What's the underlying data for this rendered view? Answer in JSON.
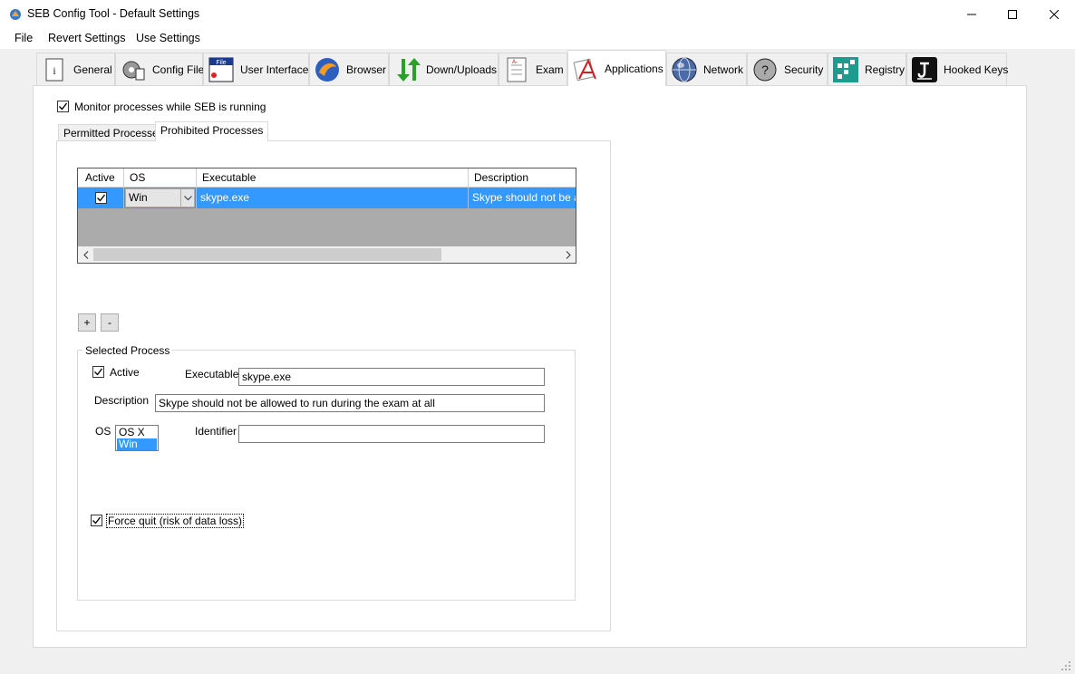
{
  "window": {
    "title": "SEB Config Tool - Default Settings",
    "controls": {
      "minimize": "—",
      "maximize": "☐",
      "close": "✕"
    }
  },
  "menu": {
    "items": [
      "File",
      "Revert Settings",
      "Use Settings"
    ]
  },
  "tabs": [
    {
      "label": "General",
      "icon": "general-icon"
    },
    {
      "label": "Config File",
      "icon": "config-file-icon"
    },
    {
      "label": "User Interface",
      "icon": "user-interface-icon"
    },
    {
      "label": "Browser",
      "icon": "browser-icon"
    },
    {
      "label": "Down/Uploads",
      "icon": "down-uploads-icon"
    },
    {
      "label": "Exam",
      "icon": "exam-icon"
    },
    {
      "label": "Applications",
      "icon": "applications-icon",
      "active": true
    },
    {
      "label": "Network",
      "icon": "network-icon"
    },
    {
      "label": "Security",
      "icon": "security-icon"
    },
    {
      "label": "Registry",
      "icon": "registry-icon"
    },
    {
      "label": "Hooked Keys",
      "icon": "hooked-keys-icon"
    }
  ],
  "applications": {
    "monitor_processes": {
      "label": "Monitor processes while SEB is running",
      "checked": true
    },
    "subtabs": [
      "Permitted Processes",
      "Prohibited Processes"
    ],
    "active_subtab": "Prohibited Processes",
    "grid": {
      "columns": [
        "Active",
        "OS",
        "Executable",
        "Description"
      ],
      "rows": [
        {
          "active": true,
          "os": "Win",
          "executable": "skype.exe",
          "description": "Skype should not be allo"
        }
      ],
      "scroll_left": "‹",
      "scroll_right": "›"
    },
    "add_button": "+",
    "remove_button": "-",
    "selected_process": {
      "group_title": "Selected Process",
      "active_label": "Active",
      "active_checked": true,
      "executable_label": "Executable",
      "executable_value": "skype.exe",
      "description_label": "Description",
      "description_value": "Skype should not be allowed to run during the exam at all",
      "os_label": "OS",
      "os_options": [
        "OS X",
        "Win"
      ],
      "os_selected": "Win",
      "identifier_label": "Identifier",
      "identifier_value": "",
      "force_quit_label": "Force quit (risk of data loss)",
      "force_quit_checked": true
    }
  },
  "colors": {
    "selection": "#3399ff",
    "window_bg": "#f0f0f0",
    "panel_bg": "#ffffff",
    "grid_empty": "#ababab"
  }
}
